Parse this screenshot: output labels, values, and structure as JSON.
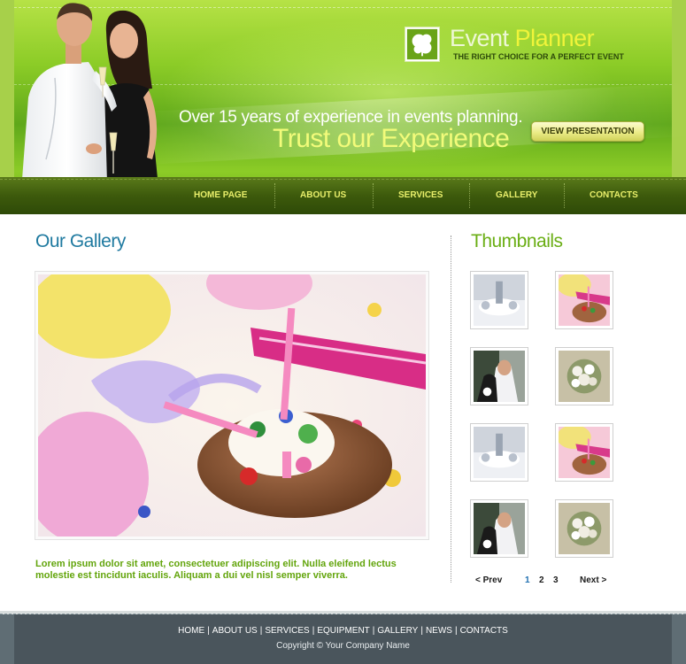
{
  "brand": {
    "name_part1": "Event",
    "name_part2": "Planner",
    "tagline": "THE RIGHT CHOICE FOR A PERFECT EVENT"
  },
  "hero": {
    "slogan_line1": "Over 15 years of experience in events planning.",
    "slogan_line2": "Trust our Experience",
    "button_label": "VIEW PRESENTATION"
  },
  "nav": {
    "items": [
      "HOME PAGE",
      "ABOUT US",
      "SERVICES",
      "GALLERY",
      "CONTACTS"
    ]
  },
  "gallery": {
    "title": "Our Gallery",
    "caption": "Lorem ipsum dolor sit amet, consectetuer adipiscing elit. Nulla eleifend lectus molestie est tincidunt iaculis. Aliquam a dui vel nisl semper viverra."
  },
  "thumbnails": {
    "title": "Thumbnails",
    "pager": {
      "prev": "< Prev",
      "pages": [
        "1",
        "2",
        "3"
      ],
      "current": "1",
      "next": "Next >"
    }
  },
  "footer": {
    "links": [
      "HOME",
      "ABOUT US",
      "SERVICES",
      "EQUIPMENT",
      "GALLERY",
      "NEWS",
      "CONTACTS"
    ],
    "copyright": "Copyright © Your Company Name"
  },
  "colors": {
    "header_green": "#8ccc27",
    "nav_dark": "#3d5a0c",
    "nav_text": "#e8ee6a",
    "heading_blue": "#1f7aa0",
    "heading_green": "#6aae14",
    "caption_green": "#63a50c",
    "footer_gray": "#4a555c"
  }
}
